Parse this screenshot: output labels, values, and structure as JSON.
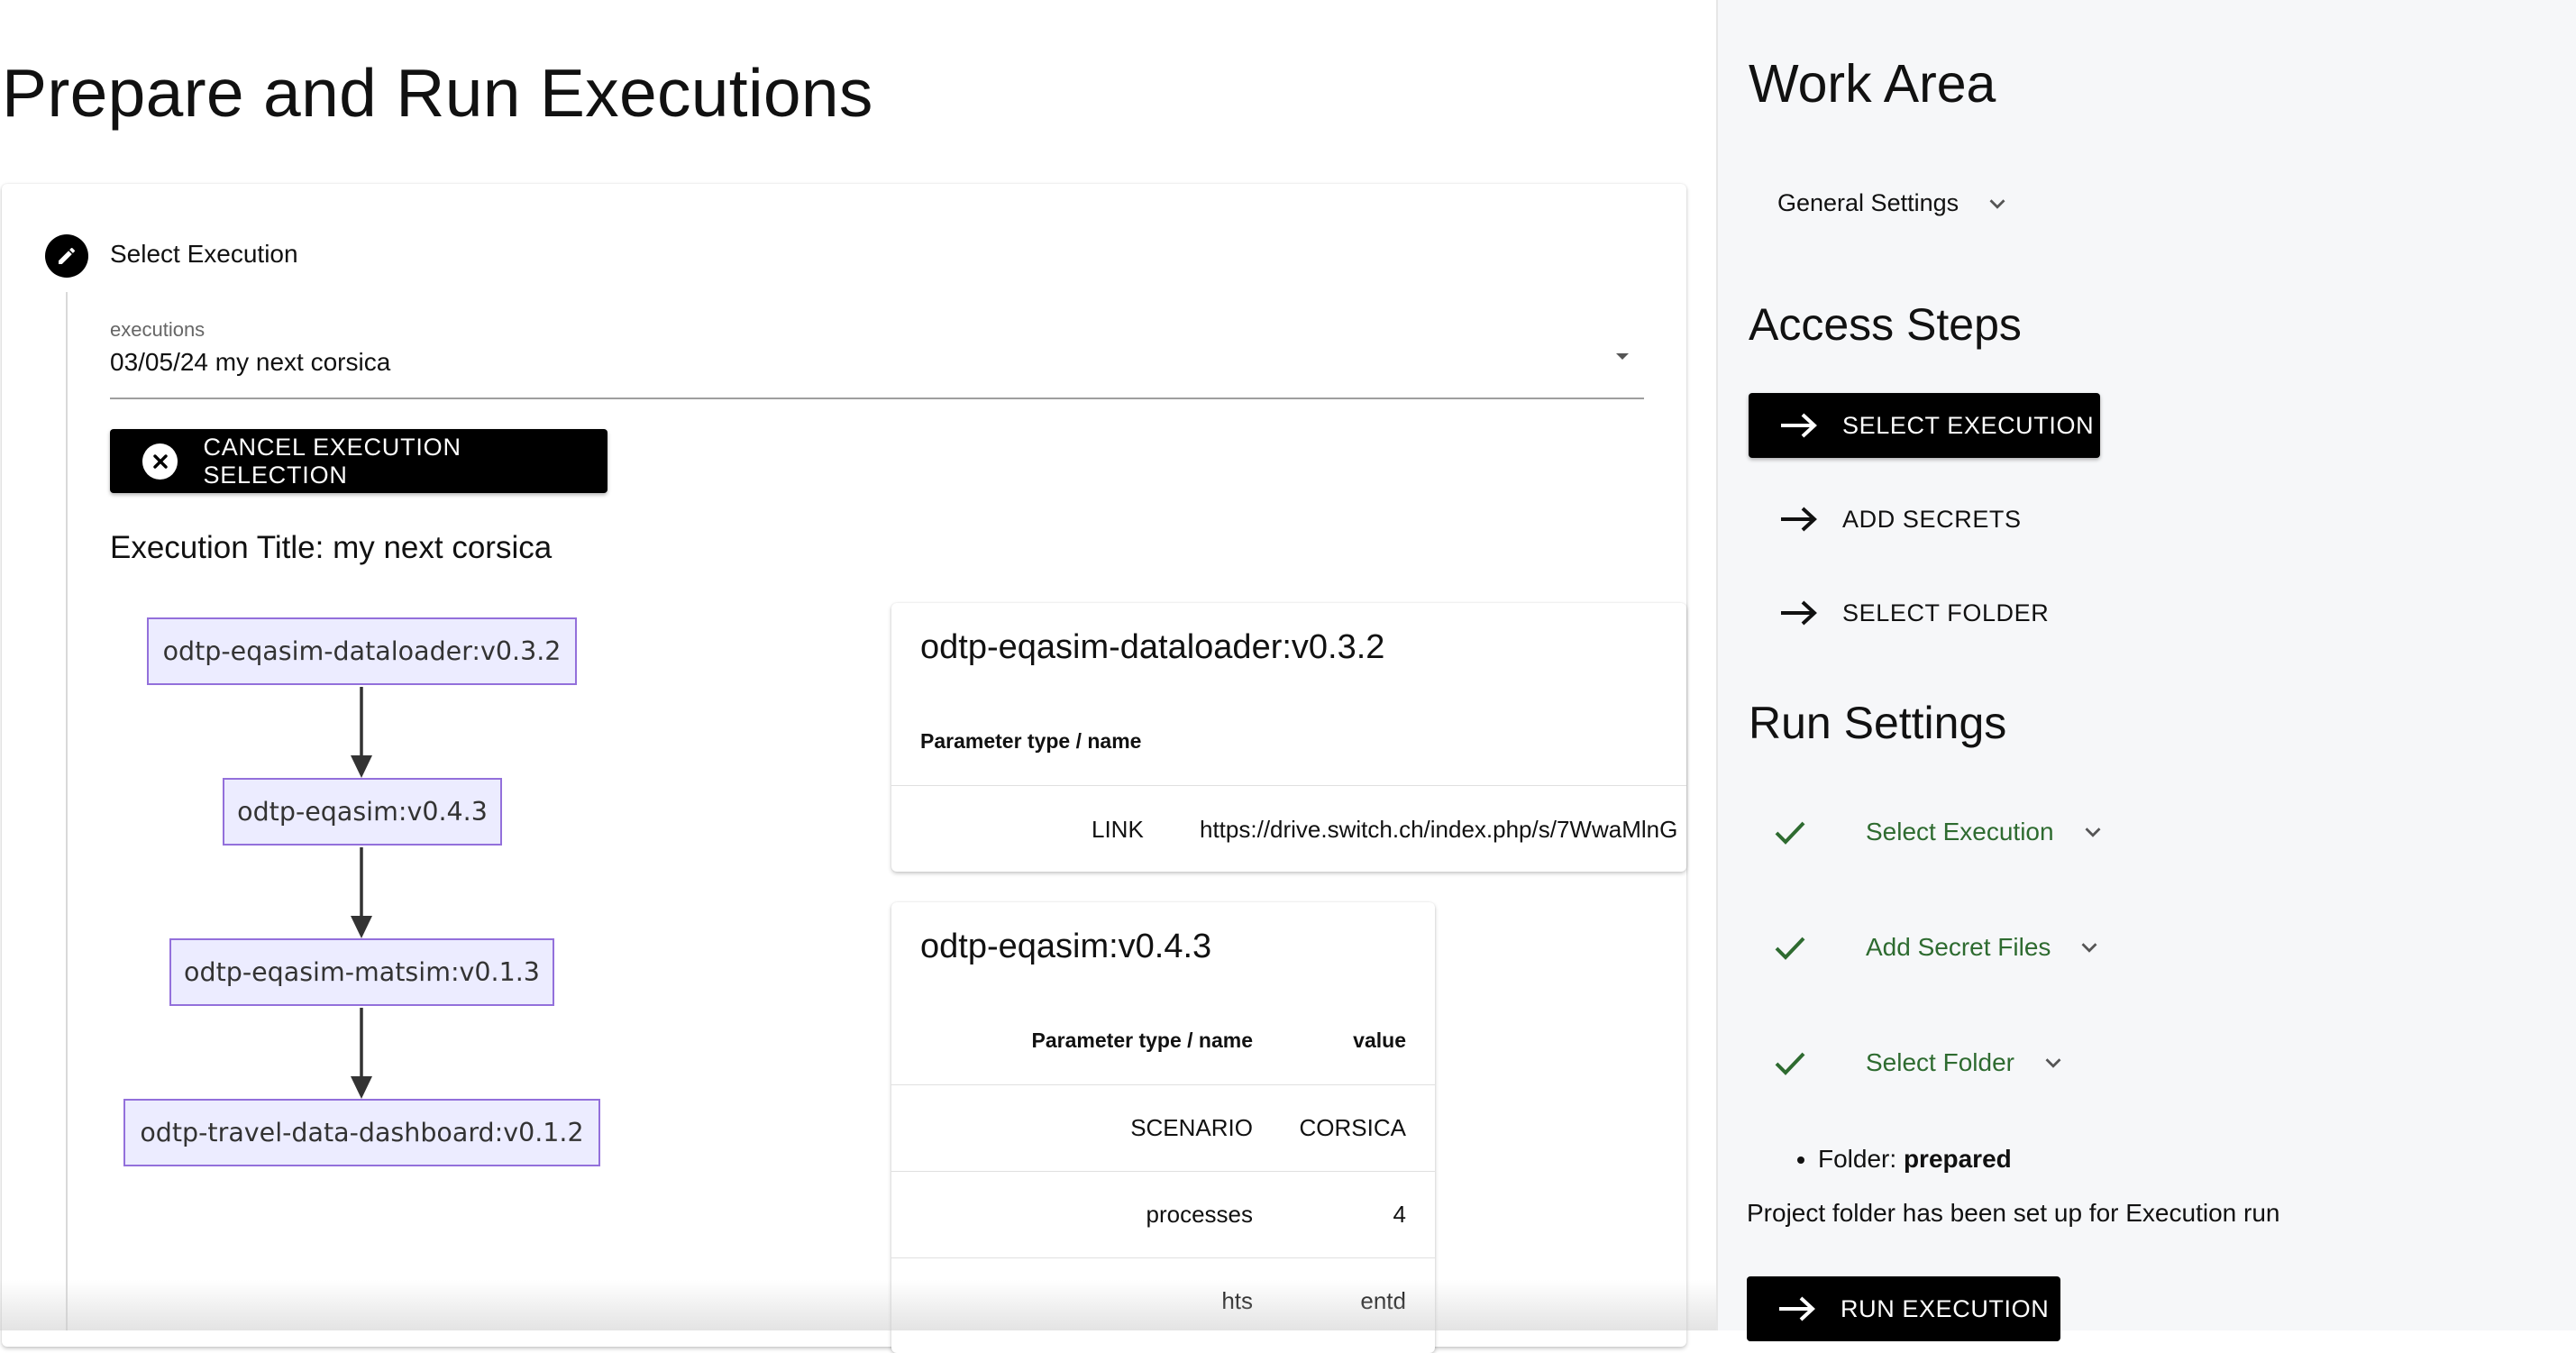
{
  "page": {
    "title": "Prepare and Run Executions"
  },
  "step": {
    "title": "Select Execution"
  },
  "select": {
    "label": "executions",
    "value": "03/05/24 my next corsica"
  },
  "cancel_button": {
    "label": "CANCEL EXECUTION SELECTION"
  },
  "execution": {
    "title": "Execution Title: my next corsica"
  },
  "flow": {
    "nodes": [
      "odtp-eqasim-dataloader:v0.3.2",
      "odtp-eqasim:v0.4.3",
      "odtp-eqasim-matsim:v0.1.3",
      "odtp-travel-data-dashboard:v0.1.2"
    ]
  },
  "panels": [
    {
      "title": "odtp-eqasim-dataloader:v0.3.2",
      "header": "Parameter type / name",
      "rows": [
        {
          "name": "LINK",
          "value": "https://drive.switch.ch/index.php/s/7WwaMlnG"
        }
      ]
    },
    {
      "title": "odtp-eqasim:v0.4.3",
      "header": "Parameter type / name",
      "value_header": "value",
      "rows": [
        {
          "name": "SCENARIO",
          "value": "CORSICA"
        },
        {
          "name": "processes",
          "value": "4"
        },
        {
          "name": "hts",
          "value": "entd"
        }
      ]
    }
  ],
  "sidebar": {
    "work_area_title": "Work Area",
    "general_settings": "General Settings",
    "access_steps_title": "Access Steps",
    "access_steps": [
      "SELECT EXECUTION",
      "ADD SECRETS",
      "SELECT FOLDER"
    ],
    "run_settings_title": "Run Settings",
    "run_steps": [
      "Select Execution",
      "Add Secret Files",
      "Select Folder"
    ],
    "folder_label": "Folder:",
    "folder_value": "prepared",
    "folder_note": "Project folder has been set up for Execution run",
    "run_button": "RUN EXECUTION"
  },
  "colors": {
    "primary": "#000000",
    "step_done": "#2e6b30",
    "flow_node_fill": "#ececff",
    "flow_node_border": "#9370db",
    "sidebar_bg": "#f6f7f9"
  }
}
